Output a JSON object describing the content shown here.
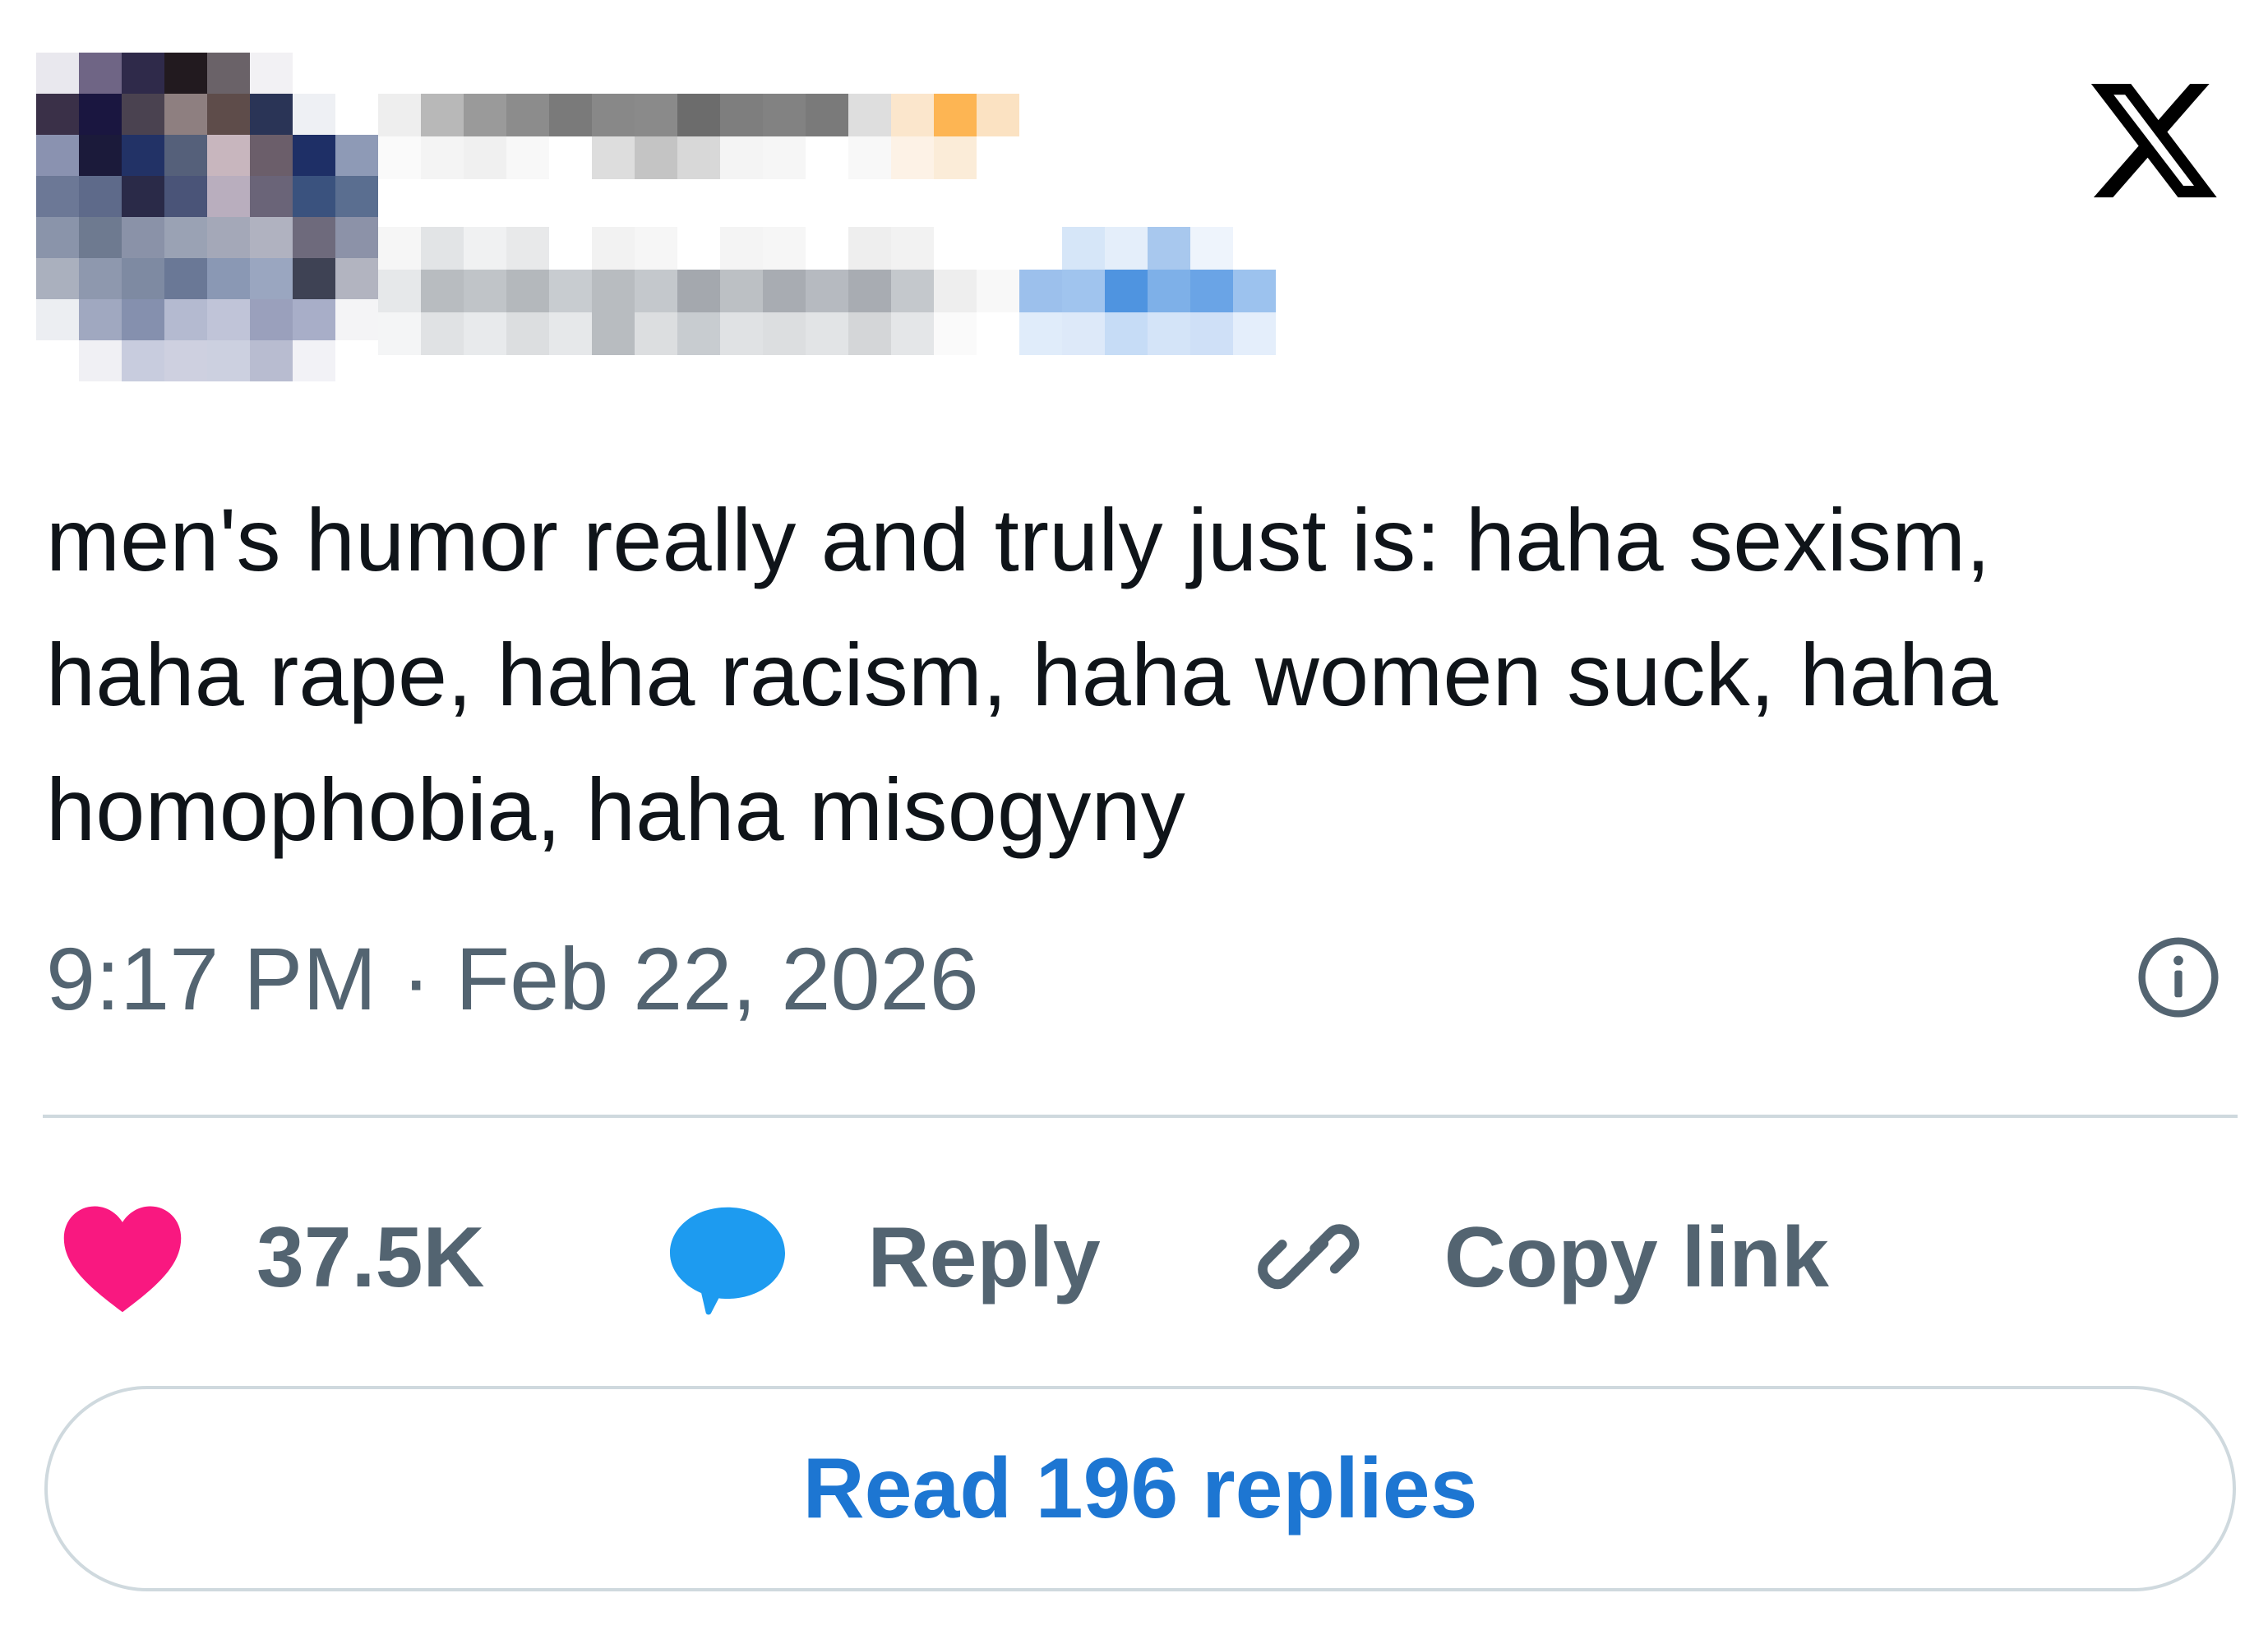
{
  "author": {
    "avatar": "avatar-pixelated",
    "display_name": "",
    "handle": "",
    "follow_label": ""
  },
  "brand": {
    "logo": "x-logo-icon"
  },
  "tweet": {
    "text": "men's humor really and truly just is: haha sexism, haha rape, haha racism, haha women suck, haha homophobia, haha misogyny",
    "timestamp": "9:17 PM · Feb 22, 2026"
  },
  "actions": {
    "like_count": "37.5K",
    "reply_label": "Reply",
    "copy_label": "Copy link"
  },
  "read_replies_label": "Read 196 replies",
  "colors": {
    "like": "#f91880",
    "reply": "#1d9bf0",
    "link_text": "#1d76d2",
    "muted": "#536471",
    "border": "#cfd9de"
  }
}
